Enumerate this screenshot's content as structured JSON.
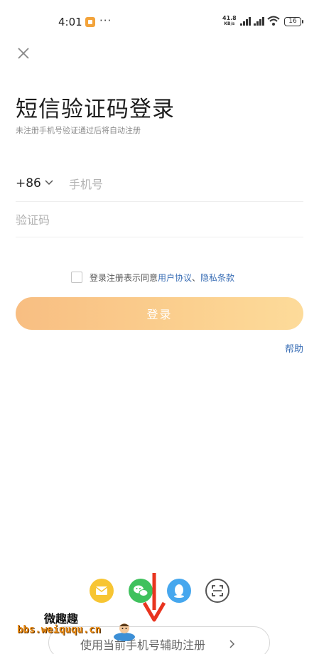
{
  "status_bar": {
    "time": "4:01",
    "more": "···",
    "speed_value": "41.8",
    "speed_unit": "KB/s",
    "battery": "16"
  },
  "header": {
    "title": "短信验证码登录",
    "subtitle": "未注册手机号验证通过后将自动注册"
  },
  "form": {
    "country_code": "+86",
    "phone_placeholder": "手机号",
    "code_placeholder": "验证码"
  },
  "agreement": {
    "text": "登录注册表示同意",
    "link_user": "用户协议",
    "separator": "、",
    "link_privacy": "隐私条款"
  },
  "login_button": "登录",
  "help_link": "帮助",
  "social": {
    "icons": [
      "mail-icon",
      "wechat-icon",
      "qq-icon",
      "scan-icon"
    ]
  },
  "assist_button": "使用当前手机号辅助注册",
  "watermark": {
    "top": "微趣趣",
    "url": "bbs.weiququ.cn"
  },
  "colors": {
    "accent_gradient_start": "#f8be82",
    "accent_gradient_end": "#fddb9a",
    "link": "#3b6fb6",
    "arrow": "#e8341f"
  }
}
